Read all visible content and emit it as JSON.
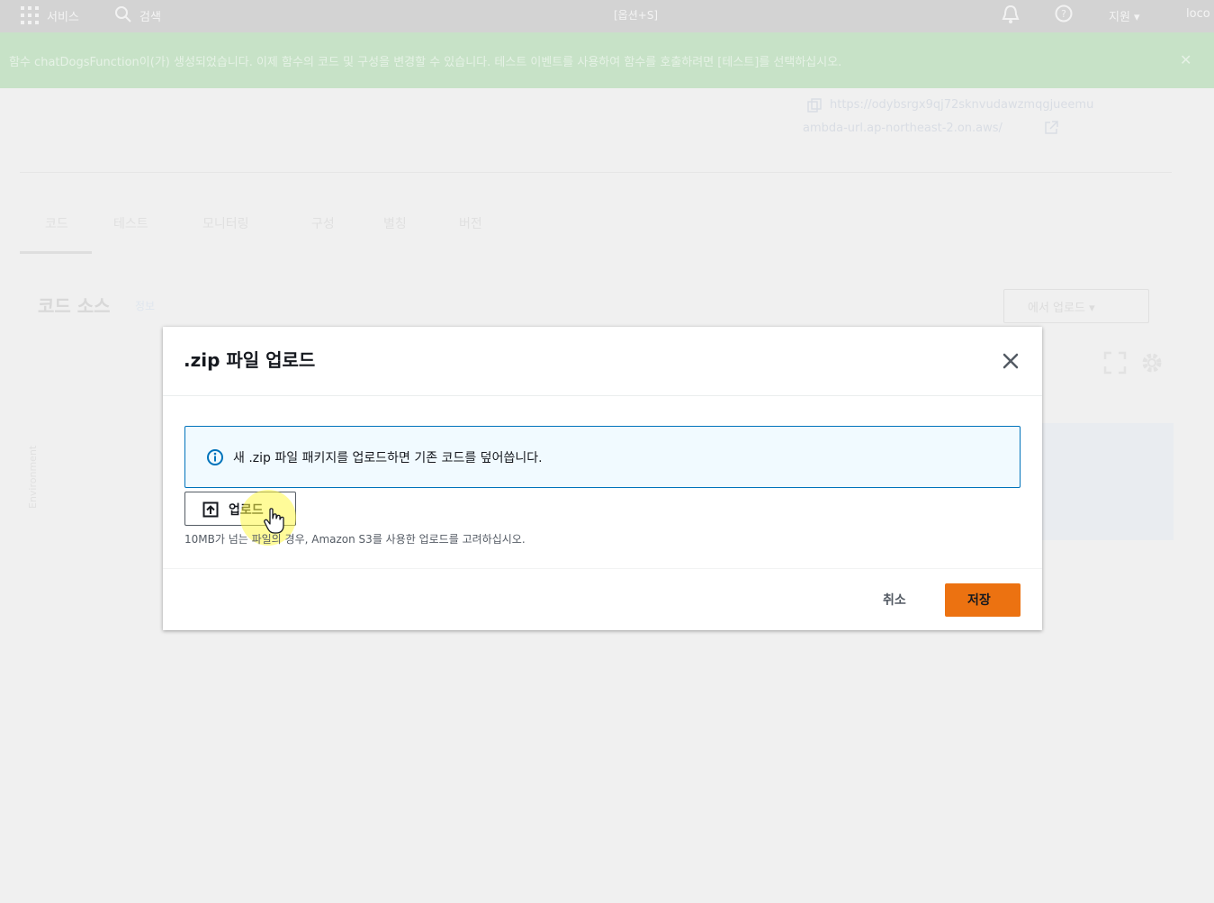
{
  "topnav": {
    "services_label": "서비스",
    "search_placeholder": "검색",
    "shortcut_hint": "[옵션+S]",
    "support_label": "지원 ▾",
    "account_label": "loco"
  },
  "banner": {
    "message": "함수 chatDogsFunction이(가) 생성되었습니다. 이제 함수의 코드 및 구성을 변경할 수 있습니다. 테스트 이벤트를 사용하여 함수를 호출하려면 [테스트]를 선택하십시오.",
    "close_glyph": "✕"
  },
  "function_url": {
    "line1": "https://odybsrgx9qj72sknvudawzmqgjueemu",
    "line2": "ambda-url.ap-northeast-2.on.aws/"
  },
  "tabs": [
    {
      "label": "코드"
    },
    {
      "label": "테스트"
    },
    {
      "label": "모니터링"
    },
    {
      "label": "구성"
    },
    {
      "label": "별칭"
    },
    {
      "label": "버전"
    }
  ],
  "code_source": {
    "title": "코드 소스",
    "info_link": "정보",
    "upload_from": "에서 업로드 ▾",
    "environment_label": "Environment"
  },
  "modal": {
    "title": ".zip 파일 업로드",
    "alert_text": "새 .zip 파일 패키지를 업로드하면 기존 코드를 덮어씁니다.",
    "upload_button": "업로드",
    "hint": "10MB가 넘는 파일의 경우, Amazon S3를 사용한 업로드를 고려하십시오.",
    "cancel_button": "취소",
    "save_button": "저장"
  },
  "colors": {
    "primary_button": "#ec7211",
    "info_border": "#0073bb",
    "info_background": "#f1faff",
    "cursor_highlight": "#fff846"
  }
}
